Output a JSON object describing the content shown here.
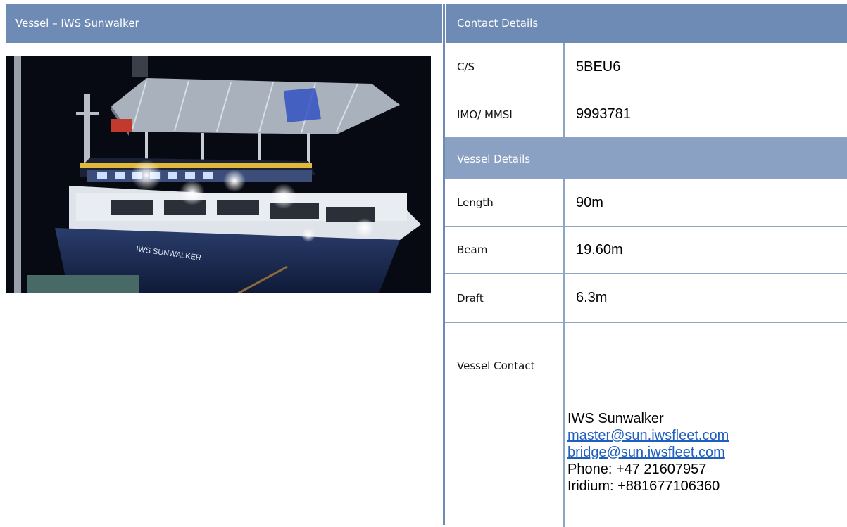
{
  "left_header": {
    "title": "Vessel – IWS Sunwalker"
  },
  "photo": {
    "hull_name": "IWS SUNWALKER"
  },
  "contact_details": {
    "title": "Contact Details",
    "rows": [
      {
        "label": "C/S",
        "value": "5BEU6"
      },
      {
        "label": "IMO/ MMSI",
        "value": "9993781"
      }
    ]
  },
  "vessel_details": {
    "title": "Vessel Details",
    "rows": [
      {
        "label": "Length",
        "value": "90m"
      },
      {
        "label": "Beam",
        "value": "19.60m"
      },
      {
        "label": "Draft",
        "value": "6.3m"
      }
    ]
  },
  "vessel_contact": {
    "label": "Vessel Contact",
    "name": "IWS Sunwalker",
    "email_master": "master@sun.iwsfleet.com",
    "email_bridge": "bridge@sun.iwsfleet.com",
    "phone": "Phone: +47 21607957",
    "iridium": "Iridium: +881677106360"
  },
  "colors": {
    "header_bg": "#6d8bb5",
    "section_bg": "#8ba1c3",
    "link": "#1f5fbf"
  }
}
